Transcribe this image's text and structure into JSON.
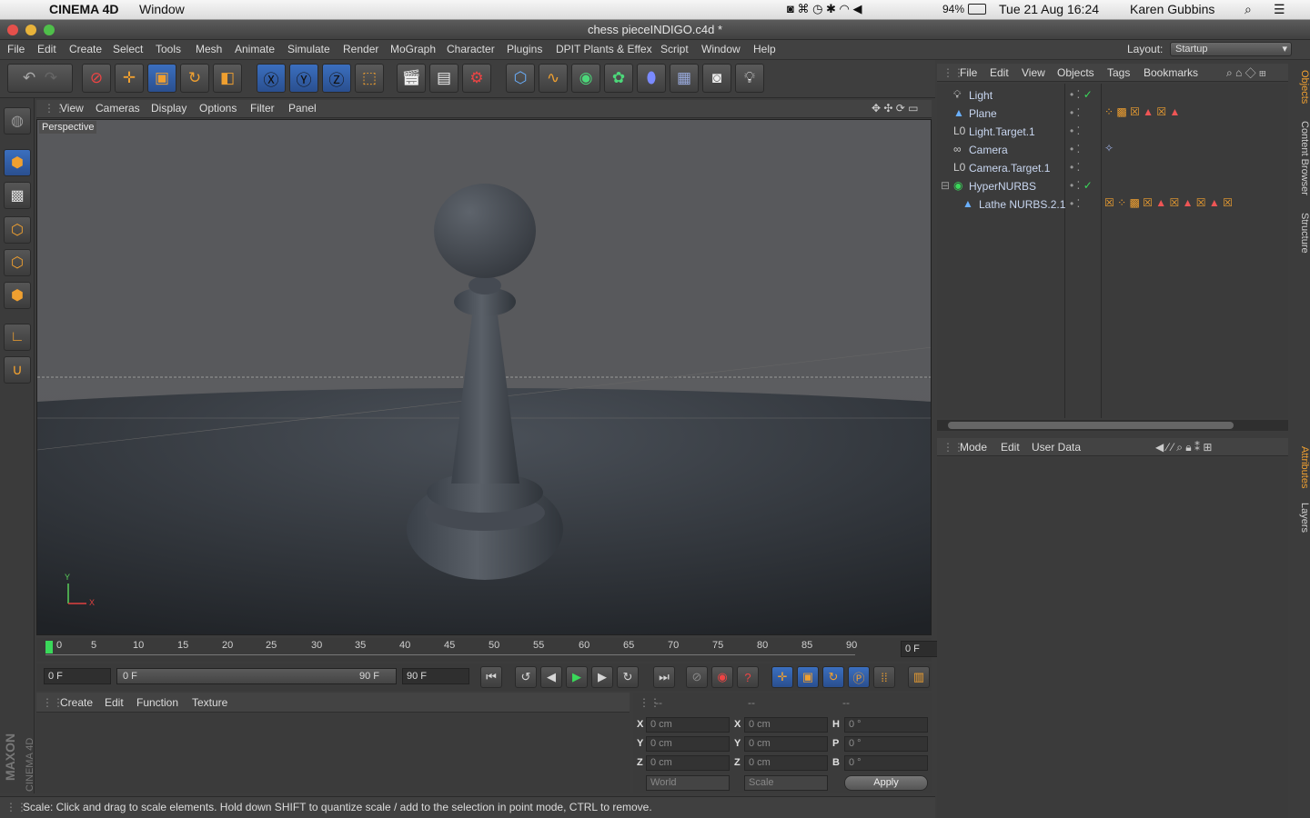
{
  "macmenubar": {
    "app_name": "CINEMA 4D",
    "window_menu": "Window",
    "battery": "94%",
    "datetime": "Tue 21 Aug  16:24",
    "user": "Karen Gubbins"
  },
  "window": {
    "title": "chess pieceINDIGO.c4d *"
  },
  "app_menu": {
    "items": [
      "File",
      "Edit",
      "Create",
      "Select",
      "Tools",
      "Mesh",
      "Animate",
      "Simulate",
      "Render",
      "MoGraph",
      "Character",
      "Plugins",
      "DPIT Plants & Effex",
      "Script",
      "Window",
      "Help"
    ],
    "layout_label": "Layout:",
    "layout_value": "Startup"
  },
  "viewport": {
    "menu": [
      "View",
      "Cameras",
      "Display",
      "Options",
      "Filter",
      "Panel"
    ],
    "label": "Perspective",
    "axis_y": "Y",
    "axis_x": "X"
  },
  "timeline": {
    "ticks": [
      "0",
      "5",
      "10",
      "15",
      "20",
      "25",
      "30",
      "35",
      "40",
      "45",
      "50",
      "55",
      "60",
      "65",
      "70",
      "75",
      "80",
      "85",
      "90"
    ],
    "current_frame": "0 F"
  },
  "transport": {
    "start_field": "0 F",
    "range_start": "0 F",
    "range_end": "90 F",
    "end_field": "90 F"
  },
  "material_manager": {
    "menu": [
      "Create",
      "Edit",
      "Function",
      "Texture"
    ]
  },
  "coordinates": {
    "headers": [
      "--",
      "--",
      "--"
    ],
    "rows": [
      {
        "l1": "X",
        "v1": "0 cm",
        "l2": "X",
        "v2": "0 cm",
        "l3": "H",
        "v3": "0 °"
      },
      {
        "l1": "Y",
        "v1": "0 cm",
        "l2": "Y",
        "v2": "0 cm",
        "l3": "P",
        "v3": "0 °"
      },
      {
        "l1": "Z",
        "v1": "0 cm",
        "l2": "Z",
        "v2": "0 cm",
        "l3": "B",
        "v3": "0 °"
      }
    ],
    "mode_select": "World",
    "type_select": "Scale",
    "apply_label": "Apply"
  },
  "status_text": "Scale: Click and drag to scale elements. Hold down SHIFT to quantize scale / add to the selection in point mode, CTRL to remove.",
  "brand": {
    "maxon": "MAXON",
    "product": "CINEMA 4D"
  },
  "object_manager": {
    "menu": [
      "File",
      "Edit",
      "View",
      "Objects",
      "Tags",
      "Bookmarks"
    ],
    "objects": [
      {
        "name": "Light",
        "icon": "light-icon"
      },
      {
        "name": "Plane",
        "icon": "plane-icon"
      },
      {
        "name": "Light.Target.1",
        "icon": "null-icon"
      },
      {
        "name": "Camera",
        "icon": "camera-icon"
      },
      {
        "name": "Camera.Target.1",
        "icon": "null-icon"
      },
      {
        "name": "HyperNURBS",
        "icon": "hypernurbs-icon"
      },
      {
        "name": "Lathe NURBS.2.1",
        "icon": "lathe-icon"
      }
    ]
  },
  "attributes": {
    "menu": [
      "Mode",
      "Edit",
      "User Data"
    ]
  },
  "side_tabs": {
    "top": [
      "Objects",
      "Content Browser",
      "Structure"
    ],
    "bottom": [
      "Attributes",
      "Layers"
    ]
  },
  "colors": {
    "accent": "#f0a030",
    "selection_blue": "#2f5f9f",
    "ui_bg": "#3c3c3c"
  }
}
